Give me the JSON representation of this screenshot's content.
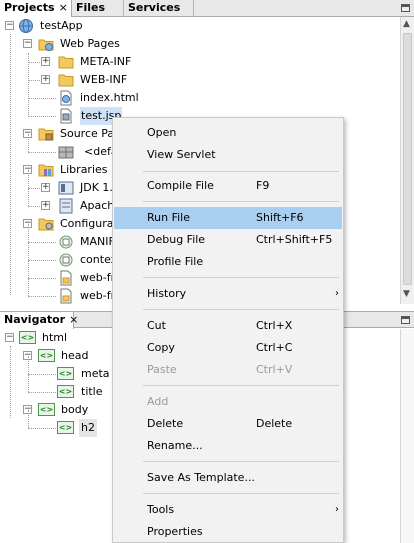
{
  "projects_panel": {
    "tabs": [
      {
        "label": "Projects",
        "close": "×"
      },
      {
        "label": "Files"
      },
      {
        "label": "Services"
      }
    ],
    "tree": {
      "root": "testApp",
      "web_pages": "Web Pages",
      "meta_inf": "META-INF",
      "web_inf": "WEB-INF",
      "index_html": "index.html",
      "test_jsp": "test.jsp",
      "source_packages": "Source Pa",
      "default_package": "<defa",
      "libraries": "Libraries",
      "jdk": "JDK 1.",
      "apache": "Apach",
      "configuration": "Configurat",
      "manifest": "MANIF",
      "context": "contex",
      "web_fr_1": "web-fr",
      "web_fr_2": "web-fr"
    }
  },
  "navigator_panel": {
    "tab": {
      "label": "Navigator",
      "close": "×"
    },
    "tree": {
      "html": "html",
      "head": "head",
      "meta": "meta",
      "title": "title",
      "body": "body",
      "h2": "h2"
    },
    "tag_icon": "<>"
  },
  "context_menu": {
    "items": [
      {
        "label": "Open"
      },
      {
        "label": "View Servlet"
      },
      {
        "label": "Compile File",
        "shortcut": "F9"
      },
      {
        "label": "Run File",
        "shortcut": "Shift+F6"
      },
      {
        "label": "Debug File",
        "shortcut": "Ctrl+Shift+F5"
      },
      {
        "label": "Profile File"
      },
      {
        "label": "History",
        "submenu": "›"
      },
      {
        "label": "Cut",
        "shortcut": "Ctrl+X"
      },
      {
        "label": "Copy",
        "shortcut": "Ctrl+C"
      },
      {
        "label": "Paste",
        "shortcut": "Ctrl+V"
      },
      {
        "label": "Add"
      },
      {
        "label": "Delete",
        "shortcut": "Delete"
      },
      {
        "label": "Rename..."
      },
      {
        "label": "Save As Template..."
      },
      {
        "label": "Tools",
        "submenu": "›"
      },
      {
        "label": "Properties"
      }
    ]
  },
  "colors": {
    "selection": "#cfe2f7",
    "menu_highlight": "#a8cff0",
    "menu_background": "#f2f2f2",
    "disabled_text": "#9a9a9a"
  }
}
